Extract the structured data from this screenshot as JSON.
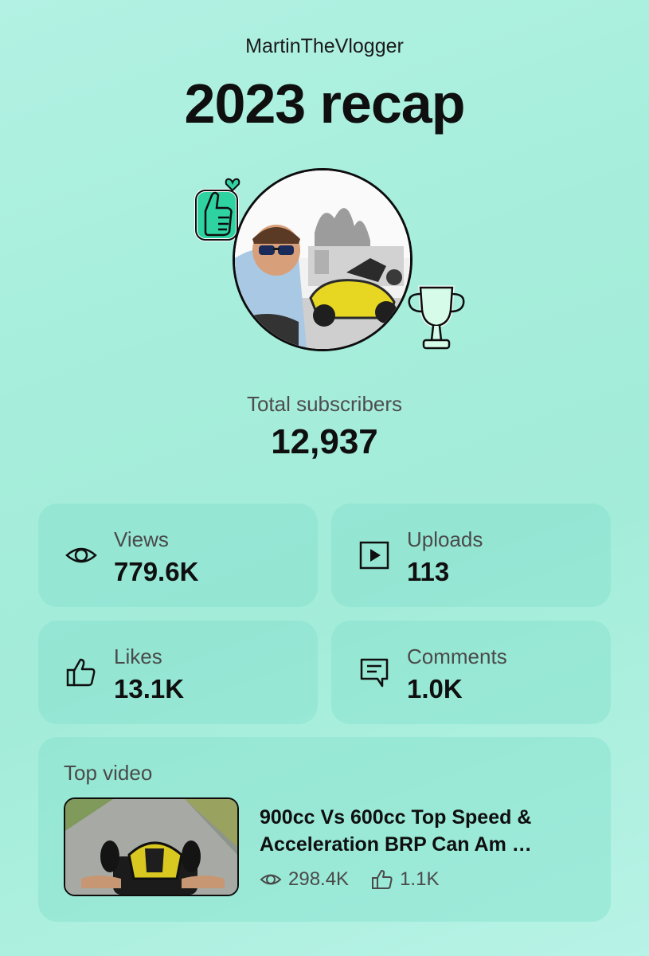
{
  "header": {
    "channel_name": "MartinTheVlogger",
    "title": "2023 recap"
  },
  "stickers": {
    "left": "thumbs-up-heart-sticker",
    "right": "trophy-sticker"
  },
  "subscribers": {
    "label": "Total subscribers",
    "count": "12,937"
  },
  "stats": [
    {
      "label": "Views",
      "value": "779.6K",
      "icon": "eye-icon"
    },
    {
      "label": "Uploads",
      "value": "113",
      "icon": "play-box-icon"
    },
    {
      "label": "Likes",
      "value": "13.1K",
      "icon": "thumbs-up-icon"
    },
    {
      "label": "Comments",
      "value": "1.0K",
      "icon": "comment-icon"
    }
  ],
  "top_video": {
    "label": "Top video",
    "title": "900cc Vs 600cc Top Speed & Acceleration BRP Can Am …",
    "views": "298.4K",
    "likes": "1.1K"
  },
  "colors": {
    "background": "#a6eedb",
    "card": "#8ee3cf",
    "sticker_green": "#2fd3a2",
    "text_primary": "#0f0f0f",
    "text_secondary": "#4a4a4a"
  }
}
